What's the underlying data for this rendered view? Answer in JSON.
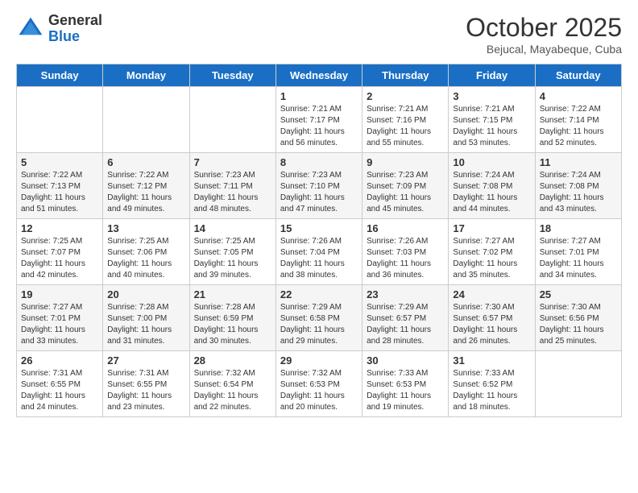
{
  "header": {
    "logo_general": "General",
    "logo_blue": "Blue",
    "month_title": "October 2025",
    "subtitle": "Bejucal, Mayabeque, Cuba"
  },
  "days_of_week": [
    "Sunday",
    "Monday",
    "Tuesday",
    "Wednesday",
    "Thursday",
    "Friday",
    "Saturday"
  ],
  "weeks": [
    [
      {
        "day": "",
        "sunrise": "",
        "sunset": "",
        "daylight": ""
      },
      {
        "day": "",
        "sunrise": "",
        "sunset": "",
        "daylight": ""
      },
      {
        "day": "",
        "sunrise": "",
        "sunset": "",
        "daylight": ""
      },
      {
        "day": "1",
        "sunrise": "Sunrise: 7:21 AM",
        "sunset": "Sunset: 7:17 PM",
        "daylight": "Daylight: 11 hours and 56 minutes."
      },
      {
        "day": "2",
        "sunrise": "Sunrise: 7:21 AM",
        "sunset": "Sunset: 7:16 PM",
        "daylight": "Daylight: 11 hours and 55 minutes."
      },
      {
        "day": "3",
        "sunrise": "Sunrise: 7:21 AM",
        "sunset": "Sunset: 7:15 PM",
        "daylight": "Daylight: 11 hours and 53 minutes."
      },
      {
        "day": "4",
        "sunrise": "Sunrise: 7:22 AM",
        "sunset": "Sunset: 7:14 PM",
        "daylight": "Daylight: 11 hours and 52 minutes."
      }
    ],
    [
      {
        "day": "5",
        "sunrise": "Sunrise: 7:22 AM",
        "sunset": "Sunset: 7:13 PM",
        "daylight": "Daylight: 11 hours and 51 minutes."
      },
      {
        "day": "6",
        "sunrise": "Sunrise: 7:22 AM",
        "sunset": "Sunset: 7:12 PM",
        "daylight": "Daylight: 11 hours and 49 minutes."
      },
      {
        "day": "7",
        "sunrise": "Sunrise: 7:23 AM",
        "sunset": "Sunset: 7:11 PM",
        "daylight": "Daylight: 11 hours and 48 minutes."
      },
      {
        "day": "8",
        "sunrise": "Sunrise: 7:23 AM",
        "sunset": "Sunset: 7:10 PM",
        "daylight": "Daylight: 11 hours and 47 minutes."
      },
      {
        "day": "9",
        "sunrise": "Sunrise: 7:23 AM",
        "sunset": "Sunset: 7:09 PM",
        "daylight": "Daylight: 11 hours and 45 minutes."
      },
      {
        "day": "10",
        "sunrise": "Sunrise: 7:24 AM",
        "sunset": "Sunset: 7:08 PM",
        "daylight": "Daylight: 11 hours and 44 minutes."
      },
      {
        "day": "11",
        "sunrise": "Sunrise: 7:24 AM",
        "sunset": "Sunset: 7:08 PM",
        "daylight": "Daylight: 11 hours and 43 minutes."
      }
    ],
    [
      {
        "day": "12",
        "sunrise": "Sunrise: 7:25 AM",
        "sunset": "Sunset: 7:07 PM",
        "daylight": "Daylight: 11 hours and 42 minutes."
      },
      {
        "day": "13",
        "sunrise": "Sunrise: 7:25 AM",
        "sunset": "Sunset: 7:06 PM",
        "daylight": "Daylight: 11 hours and 40 minutes."
      },
      {
        "day": "14",
        "sunrise": "Sunrise: 7:25 AM",
        "sunset": "Sunset: 7:05 PM",
        "daylight": "Daylight: 11 hours and 39 minutes."
      },
      {
        "day": "15",
        "sunrise": "Sunrise: 7:26 AM",
        "sunset": "Sunset: 7:04 PM",
        "daylight": "Daylight: 11 hours and 38 minutes."
      },
      {
        "day": "16",
        "sunrise": "Sunrise: 7:26 AM",
        "sunset": "Sunset: 7:03 PM",
        "daylight": "Daylight: 11 hours and 36 minutes."
      },
      {
        "day": "17",
        "sunrise": "Sunrise: 7:27 AM",
        "sunset": "Sunset: 7:02 PM",
        "daylight": "Daylight: 11 hours and 35 minutes."
      },
      {
        "day": "18",
        "sunrise": "Sunrise: 7:27 AM",
        "sunset": "Sunset: 7:01 PM",
        "daylight": "Daylight: 11 hours and 34 minutes."
      }
    ],
    [
      {
        "day": "19",
        "sunrise": "Sunrise: 7:27 AM",
        "sunset": "Sunset: 7:01 PM",
        "daylight": "Daylight: 11 hours and 33 minutes."
      },
      {
        "day": "20",
        "sunrise": "Sunrise: 7:28 AM",
        "sunset": "Sunset: 7:00 PM",
        "daylight": "Daylight: 11 hours and 31 minutes."
      },
      {
        "day": "21",
        "sunrise": "Sunrise: 7:28 AM",
        "sunset": "Sunset: 6:59 PM",
        "daylight": "Daylight: 11 hours and 30 minutes."
      },
      {
        "day": "22",
        "sunrise": "Sunrise: 7:29 AM",
        "sunset": "Sunset: 6:58 PM",
        "daylight": "Daylight: 11 hours and 29 minutes."
      },
      {
        "day": "23",
        "sunrise": "Sunrise: 7:29 AM",
        "sunset": "Sunset: 6:57 PM",
        "daylight": "Daylight: 11 hours and 28 minutes."
      },
      {
        "day": "24",
        "sunrise": "Sunrise: 7:30 AM",
        "sunset": "Sunset: 6:57 PM",
        "daylight": "Daylight: 11 hours and 26 minutes."
      },
      {
        "day": "25",
        "sunrise": "Sunrise: 7:30 AM",
        "sunset": "Sunset: 6:56 PM",
        "daylight": "Daylight: 11 hours and 25 minutes."
      }
    ],
    [
      {
        "day": "26",
        "sunrise": "Sunrise: 7:31 AM",
        "sunset": "Sunset: 6:55 PM",
        "daylight": "Daylight: 11 hours and 24 minutes."
      },
      {
        "day": "27",
        "sunrise": "Sunrise: 7:31 AM",
        "sunset": "Sunset: 6:55 PM",
        "daylight": "Daylight: 11 hours and 23 minutes."
      },
      {
        "day": "28",
        "sunrise": "Sunrise: 7:32 AM",
        "sunset": "Sunset: 6:54 PM",
        "daylight": "Daylight: 11 hours and 22 minutes."
      },
      {
        "day": "29",
        "sunrise": "Sunrise: 7:32 AM",
        "sunset": "Sunset: 6:53 PM",
        "daylight": "Daylight: 11 hours and 20 minutes."
      },
      {
        "day": "30",
        "sunrise": "Sunrise: 7:33 AM",
        "sunset": "Sunset: 6:53 PM",
        "daylight": "Daylight: 11 hours and 19 minutes."
      },
      {
        "day": "31",
        "sunrise": "Sunrise: 7:33 AM",
        "sunset": "Sunset: 6:52 PM",
        "daylight": "Daylight: 11 hours and 18 minutes."
      },
      {
        "day": "",
        "sunrise": "",
        "sunset": "",
        "daylight": ""
      }
    ]
  ]
}
